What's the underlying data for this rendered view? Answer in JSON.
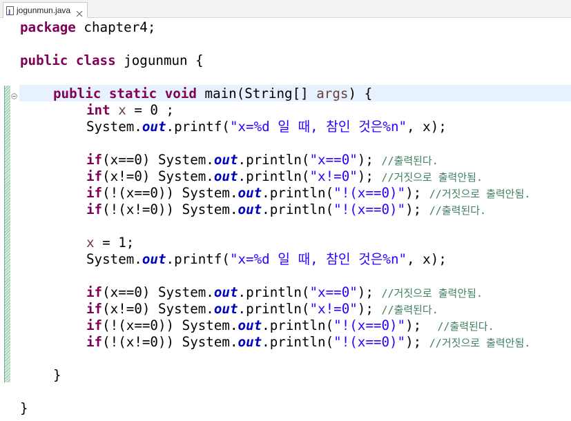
{
  "tab": {
    "filename": "jogunmun.java",
    "icon": "java-file-icon",
    "close_icon": "close-icon"
  },
  "code": {
    "package_kw": "package",
    "package_name": " chapter4;",
    "public_kw": "public",
    "class_kw": "class",
    "class_name": " jogunmun {",
    "static_kw": "static",
    "void_kw": "void",
    "main_sig": " main(String[] ",
    "args": "args",
    "main_tail": ") {",
    "int_kw": "int",
    "x": "x",
    "int_rest": " = 0 ;",
    "system_out": "System.",
    "out": "out",
    "printf": ".printf(",
    "println": ".println(",
    "printf_fmt": "\"x=%d 일 때, 참인 것은%n\"",
    "printf_tail": ", x);",
    "if_kw": "if",
    "cond_1": "(x==0)",
    "cond_2": "(x!=0)",
    "cond_3": "(!(x==0))",
    "cond_4": "(!(x!=0))",
    "str_1": "\"x==0\"",
    "str_2": "\"x!=0\"",
    "str_3": "\"!(x==0)\"",
    "str_4": "\"!(x==0)\"",
    "stmt_end": ");",
    "cmt_printed": "//출력된다.",
    "cmt_false": "//거짓으로 출력안됨.",
    "assign_1": " = 1;",
    "close_method": "}",
    "close_class": "}"
  },
  "colors": {
    "keyword": "#7f0055",
    "string": "#2a00ff",
    "field": "#0000c0",
    "comment": "#3f7f5f",
    "current_line": "#e8f2fe"
  }
}
